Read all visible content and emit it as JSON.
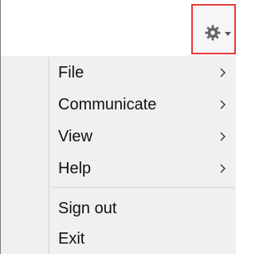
{
  "menu": {
    "items": [
      {
        "label": "File",
        "has_submenu": true
      },
      {
        "label": "Communicate",
        "has_submenu": true
      },
      {
        "label": "View",
        "has_submenu": true
      },
      {
        "label": "Help",
        "has_submenu": true
      },
      {
        "label": "Sign out",
        "has_submenu": false
      },
      {
        "label": "Exit",
        "has_submenu": false
      }
    ]
  },
  "toolbar": {
    "settings_icon": "gear-icon",
    "dropdown_icon": "caret-down-icon"
  },
  "colors": {
    "highlight_border": "#e53a3a",
    "menu_background": "#f0f0f0"
  }
}
